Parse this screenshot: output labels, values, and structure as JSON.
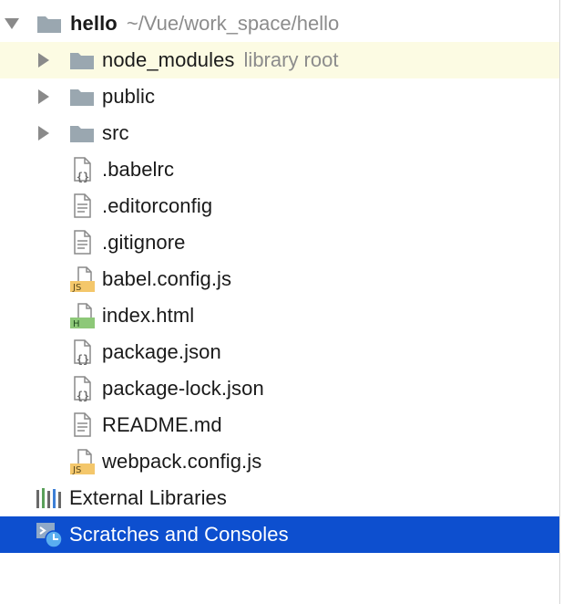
{
  "project": {
    "name": "hello",
    "path": "~/Vue/work_space/hello"
  },
  "folders": [
    {
      "name": "node_modules",
      "hint": "library root"
    },
    {
      "name": "public"
    },
    {
      "name": "src"
    }
  ],
  "files": [
    {
      "name": ".babelrc",
      "type": "json"
    },
    {
      "name": ".editorconfig",
      "type": "text"
    },
    {
      "name": ".gitignore",
      "type": "text"
    },
    {
      "name": "babel.config.js",
      "type": "js"
    },
    {
      "name": "index.html",
      "type": "html"
    },
    {
      "name": "package.json",
      "type": "json"
    },
    {
      "name": "package-lock.json",
      "type": "json"
    },
    {
      "name": "README.md",
      "type": "text"
    },
    {
      "name": "webpack.config.js",
      "type": "js"
    }
  ],
  "external_libraries": {
    "label": "External Libraries"
  },
  "scratches": {
    "label": "Scratches and Consoles"
  },
  "badges": {
    "js": "JS",
    "html": "H"
  },
  "colors": {
    "selection": "#0d4fcf",
    "highlight": "#fcfbe3",
    "folder": "#9aa7b0",
    "js_badge": "#f4c76b",
    "html_badge": "#8dc878"
  }
}
